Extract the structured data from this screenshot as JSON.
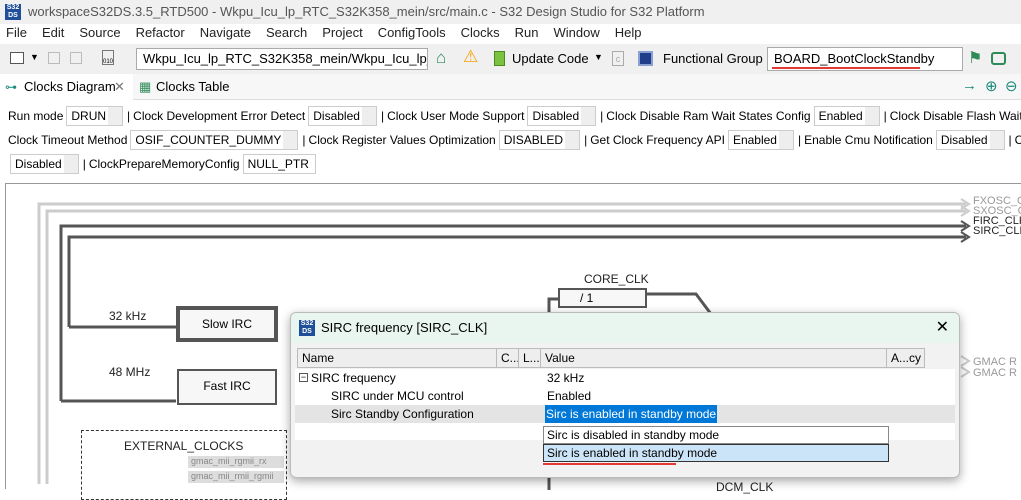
{
  "window": {
    "title": "workspaceS32DS.3.5_RTD500 - Wkpu_Icu_lp_RTC_S32K358_mein/src/main.c - S32 Design Studio for S32 Platform",
    "logo": "S32 DS"
  },
  "menu": [
    "File",
    "Edit",
    "Source",
    "Refactor",
    "Navigate",
    "Search",
    "Project",
    "ConfigTools",
    "Clocks",
    "Run",
    "Window",
    "Help"
  ],
  "toolbar": {
    "path": "Wkpu_Icu_lp_RTC_S32K358_mein/Wkpu_Icu_lp_RTC_",
    "update_code": "Update Code",
    "functional_group_label": "Functional Group",
    "functional_group": "BOARD_BootClockStandby"
  },
  "tabs": [
    {
      "label": "Clocks Diagram"
    },
    {
      "label": "Clocks Table"
    }
  ],
  "settings": {
    "row1": [
      {
        "label": "Run mode",
        "value": "DRUN"
      },
      {
        "label": "Clock Development Error Detect",
        "value": "Disabled"
      },
      {
        "label": "Clock User Mode Support",
        "value": "Disabled"
      },
      {
        "label": "Clock Disable Ram Wait States Config",
        "value": "Enabled"
      },
      {
        "label": "Clock Disable Flash Wait"
      }
    ],
    "row2": [
      {
        "label": "Clock Timeout Method",
        "value": "OSIF_COUNTER_DUMMY"
      },
      {
        "label": "Clock Register Values Optimization",
        "value": "DISABLED"
      },
      {
        "label": "Get Clock Frequency API",
        "value": "Enabled"
      },
      {
        "label": "Enable Cmu Notification",
        "value": "Disabled"
      },
      {
        "label": "C"
      }
    ],
    "row3": [
      {
        "value": "Disabled"
      },
      {
        "label": "ClockPrepareMemoryConfig",
        "value": "NULL_PTR"
      }
    ]
  },
  "diagram": {
    "slow_freq": "32 kHz",
    "slow_irc": "Slow IRC",
    "fast_freq": "48 MHz",
    "fast_irc": "Fast IRC",
    "core_clk": "CORE_CLK",
    "core_div": "/ 1",
    "external": "EXTERNAL_CLOCKS",
    "ext1": "gmac_mii_rgmii_rx",
    "ext2": "gmac_mii_rmii_rgmii",
    "outputs": [
      "FXOSC_CLK",
      "SXOSC_CLK",
      "FIRC_CLK",
      "SIRC_CLK"
    ],
    "gmac": [
      "GMAC R",
      "GMAC R"
    ],
    "dcm": "DCM_CLK"
  },
  "dialog": {
    "title": "SIRC frequency [SIRC_CLK]",
    "columns": [
      "Name",
      "C...",
      "L...",
      "Value",
      "A...cy"
    ],
    "rows": [
      {
        "name": "SIRC frequency",
        "value": "32 kHz"
      },
      {
        "name": "SIRC under MCU control",
        "value": "Enabled"
      },
      {
        "name": "Sirc Standby Configuration",
        "value": "Sirc is enabled in standby mode"
      }
    ],
    "options": [
      "Sirc is disabled in standby mode",
      "Sirc is enabled in standby mode"
    ]
  },
  "colors": {
    "accent": "#0078d7",
    "highlight_red": "#e53935",
    "dialog_title": "#e9f6ef"
  }
}
